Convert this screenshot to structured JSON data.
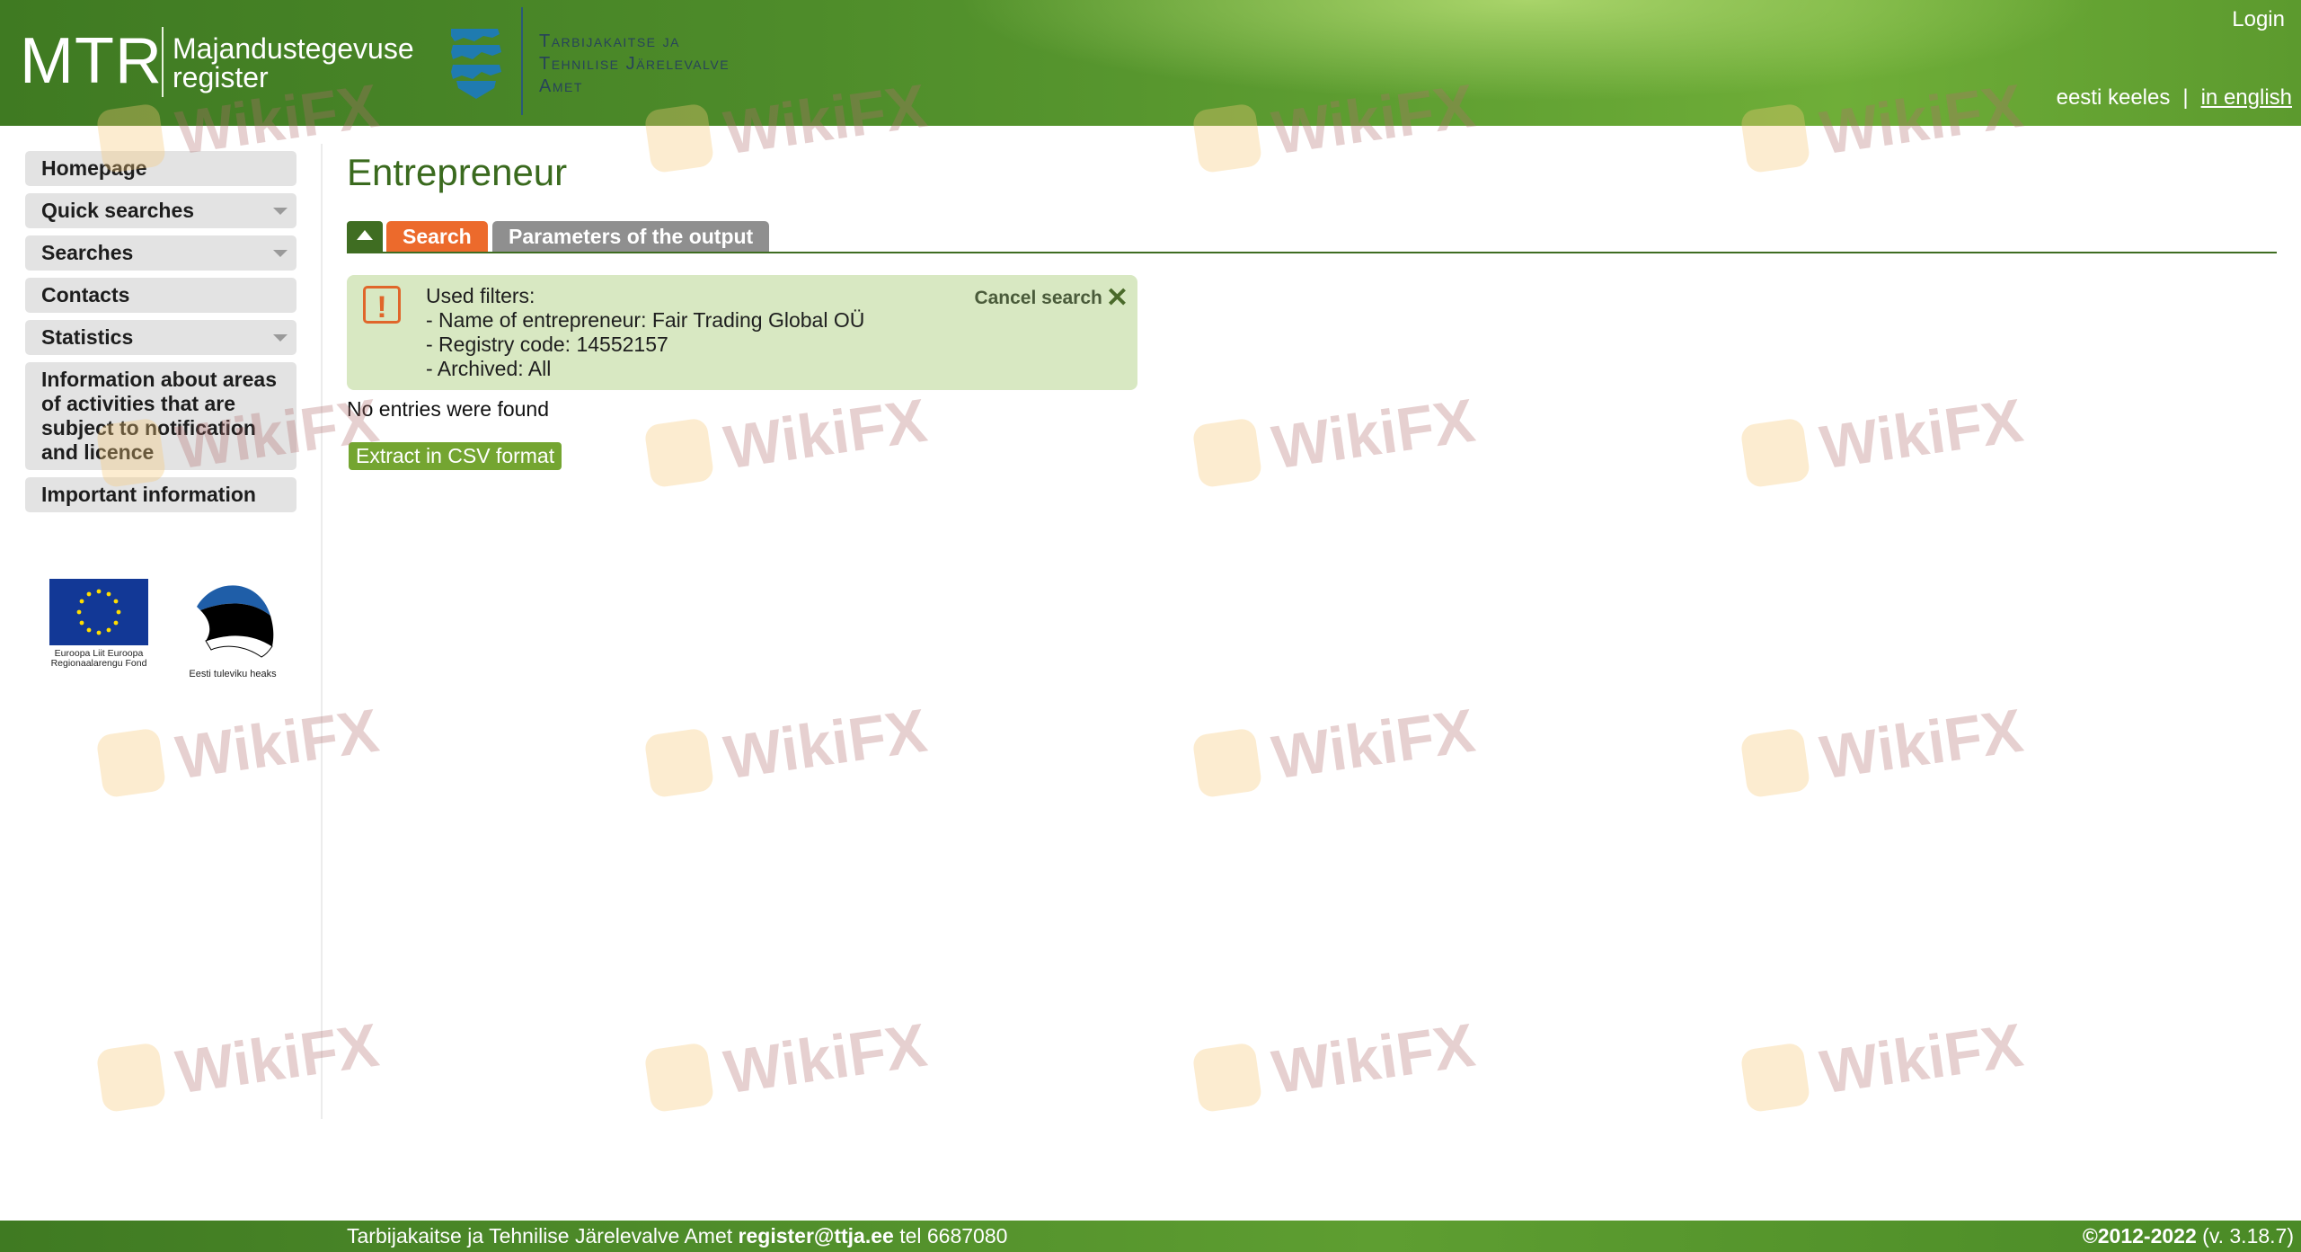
{
  "header": {
    "logo_main": "MTR",
    "logo_sub_line1": "Majandustegevuse",
    "logo_sub_line2": "register",
    "agency_line1": "Tarbijakaitse ja",
    "agency_line2": "Tehnilise Järelevalve",
    "agency_line3": "Amet",
    "login": "Login",
    "lang_et": "eesti keeles",
    "lang_sep": "|",
    "lang_en": "in english"
  },
  "sidebar": {
    "items": [
      {
        "label": "Homepage"
      },
      {
        "label": "Quick searches"
      },
      {
        "label": "Searches"
      },
      {
        "label": "Contacts"
      },
      {
        "label": "Statistics"
      },
      {
        "label": "Information about areas of activities that are subject to notification and licence"
      },
      {
        "label": "Important information"
      }
    ],
    "eu_logo_text": "Euroopa Liit Euroopa Regionaalarengu Fond",
    "ee_logo_text": "Eesti tuleviku heaks"
  },
  "main": {
    "title": "Entrepreneur",
    "tabs": {
      "search": "Search",
      "params": "Parameters of the output"
    },
    "filters": {
      "heading": "Used filters:",
      "lines": [
        "- Name of entrepreneur: Fair Trading Global OÜ",
        "- Registry code: 14552157",
        "- Archived: All"
      ],
      "cancel": "Cancel search",
      "cancel_icon": "✕",
      "alert_icon": "!"
    },
    "no_entries": "No entries were found",
    "csv_button": "Extract in CSV format"
  },
  "watermark": "WikiFX",
  "footer": {
    "agency": "Tarbijakaitse ja Tehnilise Järelevalve Amet",
    "email": "register@ttja.ee",
    "tel": "tel 6687080",
    "copyright": "©2012-2022",
    "version": "(v. 3.18.7)"
  },
  "colors": {
    "brand_green": "#3f7a22",
    "accent_orange": "#ec6a2c",
    "filter_bg": "#d8e8c2",
    "title_green": "#3a6a1e"
  }
}
